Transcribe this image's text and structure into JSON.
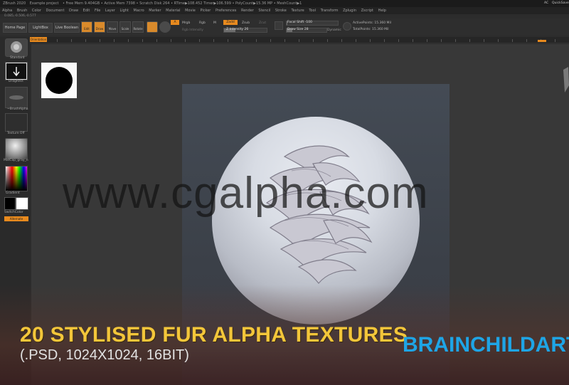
{
  "titlebar": {
    "app": "ZBrush 2020",
    "project": "Example project",
    "stats": "• Free Mem 9.404GB • Active Mem 7398 • Scratch Disk 264 • RTime▶108.452 Timer▶106.599 • PolyCount▶15.36 MP • MeshCount▶1",
    "right": "AC",
    "quicksave": "QuickSave"
  },
  "menubar": {
    "items": [
      "Alpha",
      "Brush",
      "Color",
      "Document",
      "Draw",
      "Edit",
      "File",
      "Layer",
      "Light",
      "Macro",
      "Marker",
      "Material",
      "Movie",
      "Picker",
      "Preferences",
      "Render",
      "Stencil",
      "Stroke",
      "Texture",
      "Tool",
      "Transform",
      "Zplugin",
      "Zscript",
      "Help"
    ]
  },
  "statsline": "0.085,-0.506,-0.577",
  "toolbar": {
    "home_page": "Home Page",
    "lightbox": "LightBox",
    "live_boolean": "Live Boolean",
    "edit": "Edit",
    "draw": "Draw",
    "move": "Move",
    "scale": "Scale",
    "rotate": "Rotate",
    "a_label": "A",
    "mrgb": "Mrgb",
    "rgb": "Rgb",
    "m": "M",
    "zadd": "Zadd",
    "zsub": "Zsub",
    "zcut": "Zcut",
    "rgb_intensity": "Rgb Intensity",
    "z_intensity": "Z Intensity 26",
    "focal_shift": "Focal Shift -100",
    "draw_size": "Draw Size 28",
    "dynamic": "Dynamic",
    "active_points": "ActivePoints: 15.360 Mil",
    "total_points": "TotalPoints: 15.360 Mil"
  },
  "ruler": {
    "tag1": "Orientation",
    "tag2": "Perspective Enable"
  },
  "leftshelf": {
    "brush_label": "Standard",
    "stroke_label": "DragRect",
    "alpha_label": "~BrushAlpha",
    "texture_label": "Texture Off",
    "material_label": "MatCap_gray_n",
    "gradient_label": "Gradient",
    "switchcolor_label": "SwitchColor",
    "alternate_label": "Alternate"
  },
  "canvas": {
    "watermark": "www.cgalpha.com"
  },
  "overlay": {
    "headline": "20 STYLISED FUR ALPHA TEXTURES",
    "subline": "(.PSD, 1024X1024, 16BIT)",
    "brand": "BRAINCHILDART."
  },
  "colors": {
    "accent_orange": "#e88a1e",
    "headline_yellow": "#f3c63a",
    "brand_blue": "#1ea5e6"
  }
}
